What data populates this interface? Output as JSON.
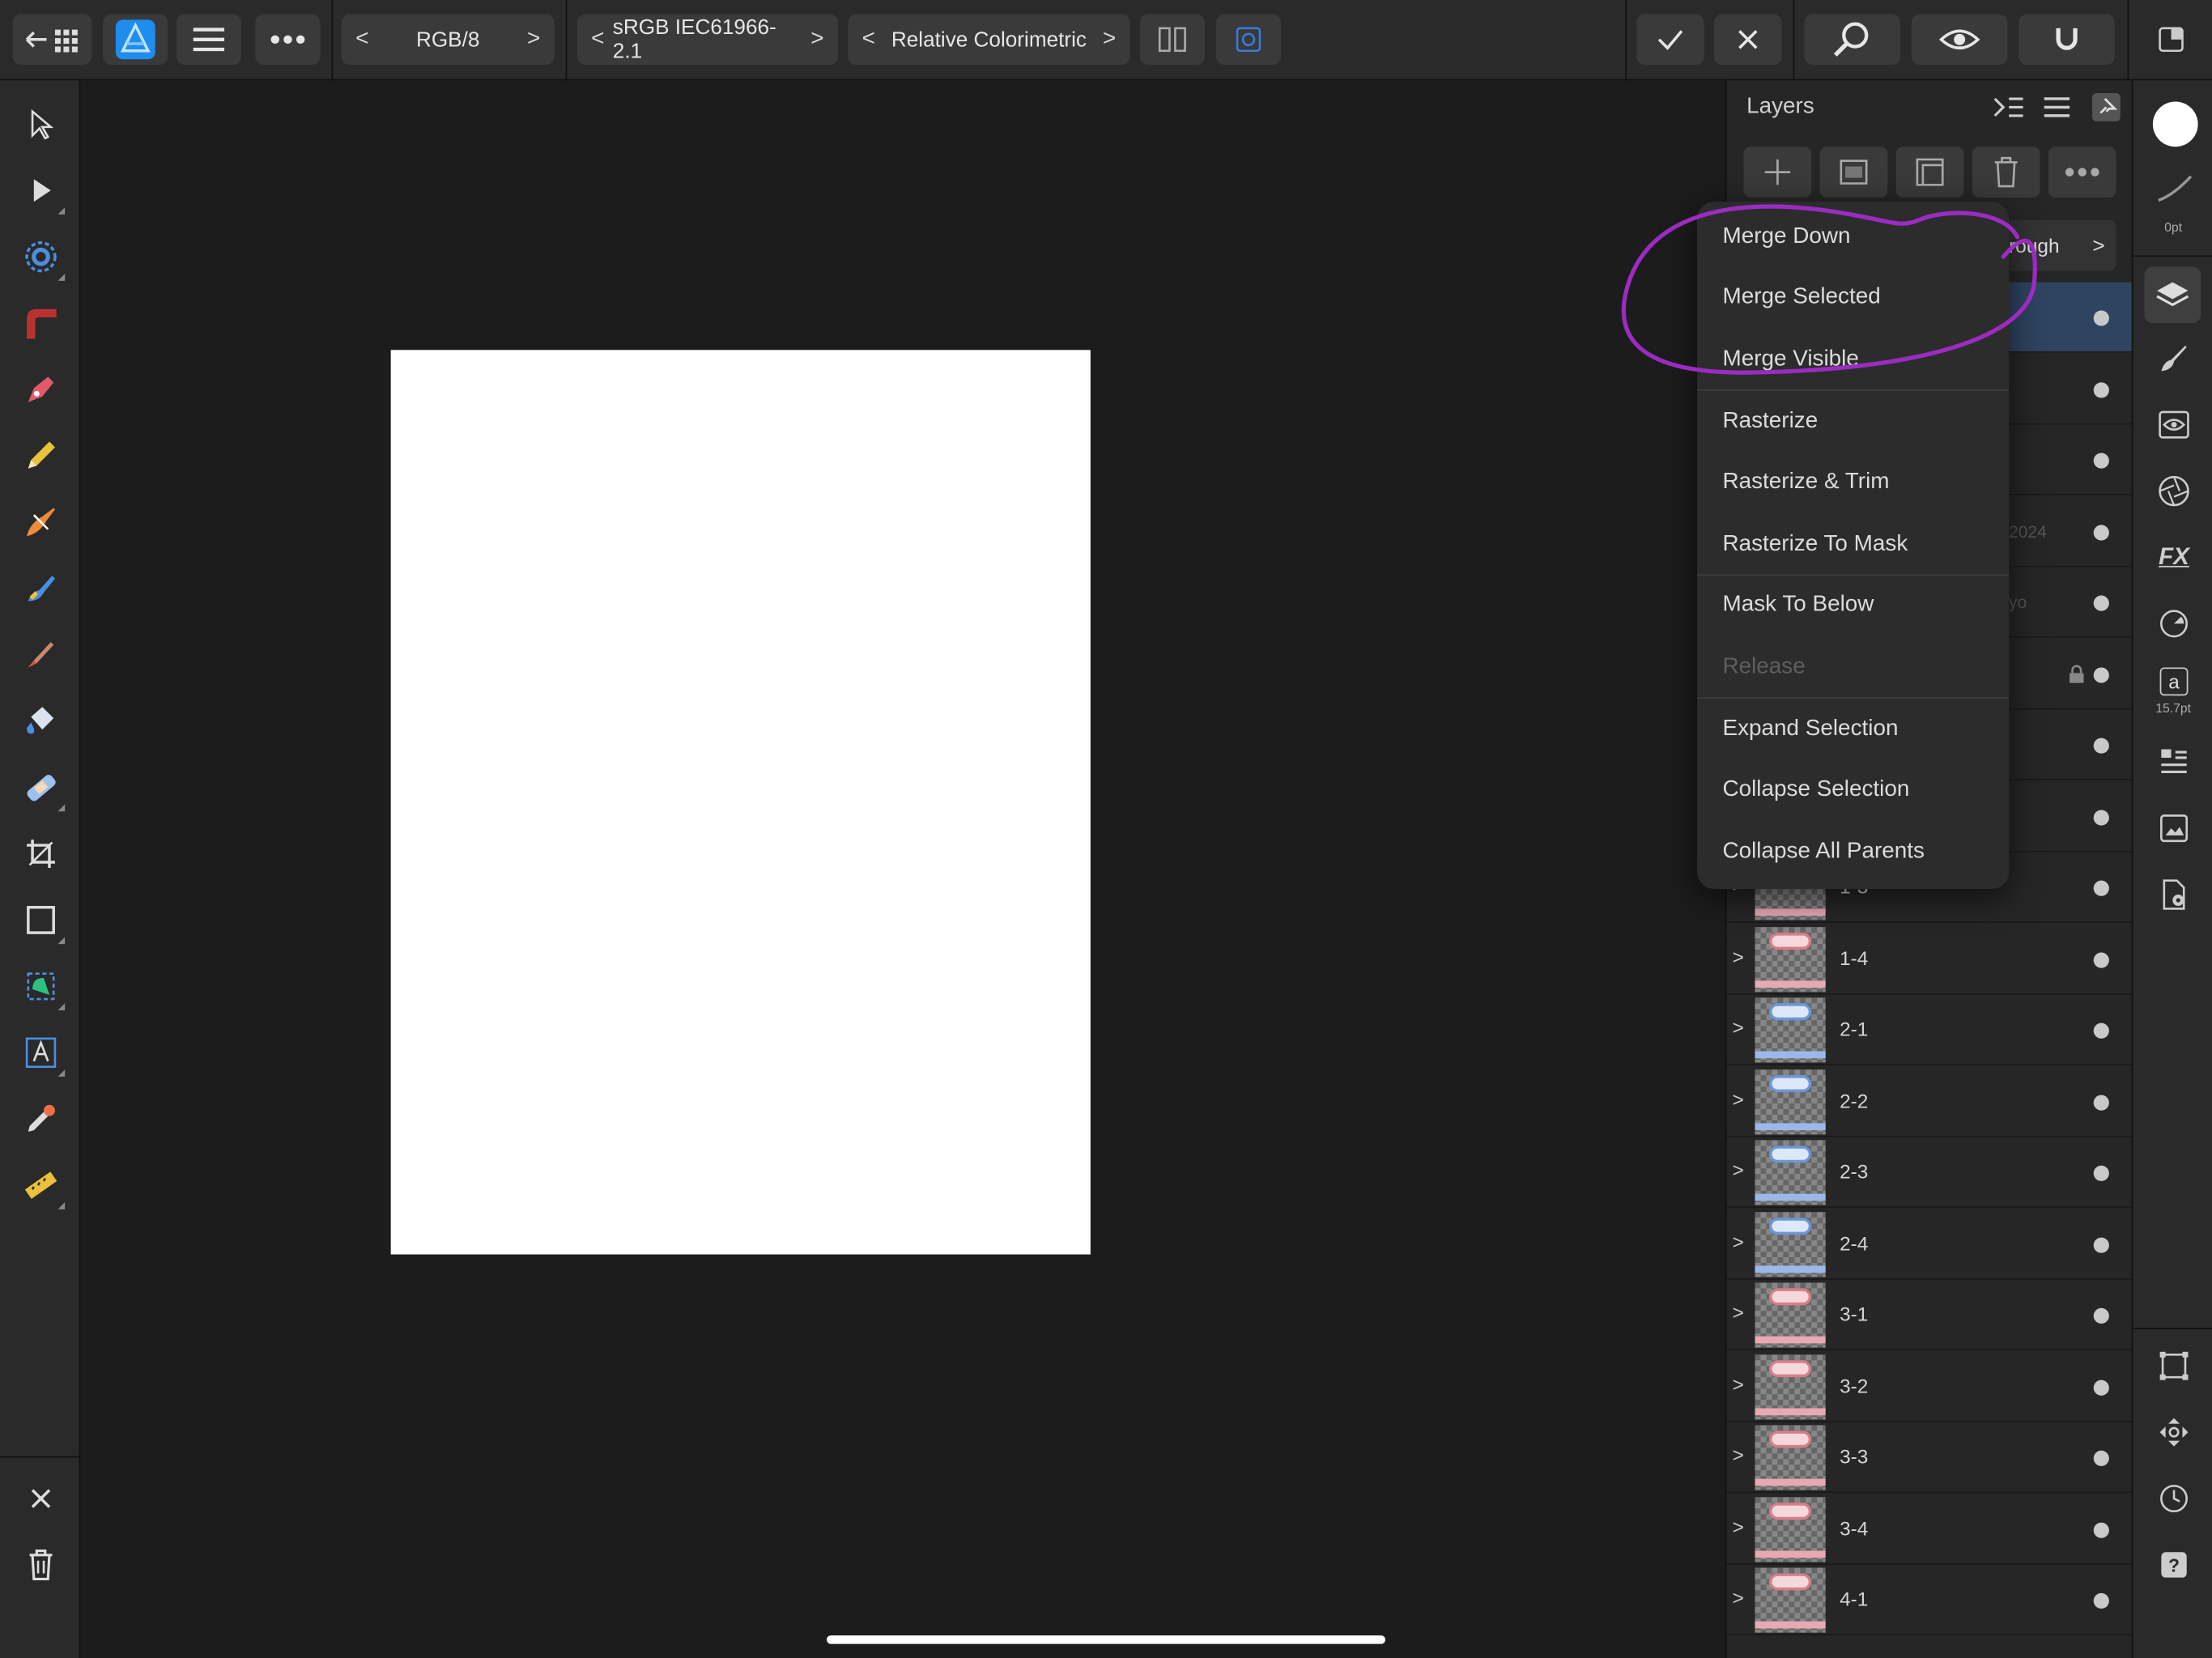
{
  "topbar": {
    "color_format": "RGB/8",
    "color_profile": "sRGB IEC61966-2.1",
    "rendering_intent": "Relative Colorimetric",
    "nav_prev": "<",
    "nav_next": ">"
  },
  "layers_panel": {
    "title": "Layers",
    "blend_mode_partial": "rough",
    "ghost_texts": [
      "2024",
      "yo"
    ],
    "rows": [
      {
        "name": "",
        "selected": true
      },
      {
        "name": ""
      },
      {
        "name": ""
      },
      {
        "name": ""
      },
      {
        "name": ""
      },
      {
        "name": "",
        "locked": true
      },
      {
        "name": ""
      },
      {
        "name": ""
      },
      {
        "name": "1-3"
      },
      {
        "name": "1-4"
      },
      {
        "name": "2-1"
      },
      {
        "name": "2-2"
      },
      {
        "name": "2-3"
      },
      {
        "name": "2-4"
      },
      {
        "name": "3-1"
      },
      {
        "name": "3-2"
      },
      {
        "name": "3-3"
      },
      {
        "name": "3-4"
      },
      {
        "name": "4-1"
      }
    ]
  },
  "context_menu": {
    "items": [
      {
        "label": "Merge Down",
        "enabled": true
      },
      {
        "label": "Merge Selected",
        "enabled": true
      },
      {
        "label": "Merge Visible",
        "enabled": true
      },
      {
        "label": "Rasterize",
        "enabled": true
      },
      {
        "label": "Rasterize & Trim",
        "enabled": true
      },
      {
        "label": "Rasterize To Mask",
        "enabled": true
      },
      {
        "label": "Mask To Below",
        "enabled": true
      },
      {
        "label": "Release",
        "enabled": false
      },
      {
        "label": "Expand Selection",
        "enabled": true
      },
      {
        "label": "Collapse Selection",
        "enabled": true
      },
      {
        "label": "Collapse All Parents",
        "enabled": true
      }
    ]
  },
  "studio_strip": {
    "stroke_width": "0pt",
    "font_size": "15.7pt",
    "char_icon": "a",
    "fx_label": "FX",
    "help_label": "?"
  },
  "colors": {
    "annotation": "#9b2bc1",
    "selected_row": "#2f4460",
    "brand": "#1f8ded"
  }
}
